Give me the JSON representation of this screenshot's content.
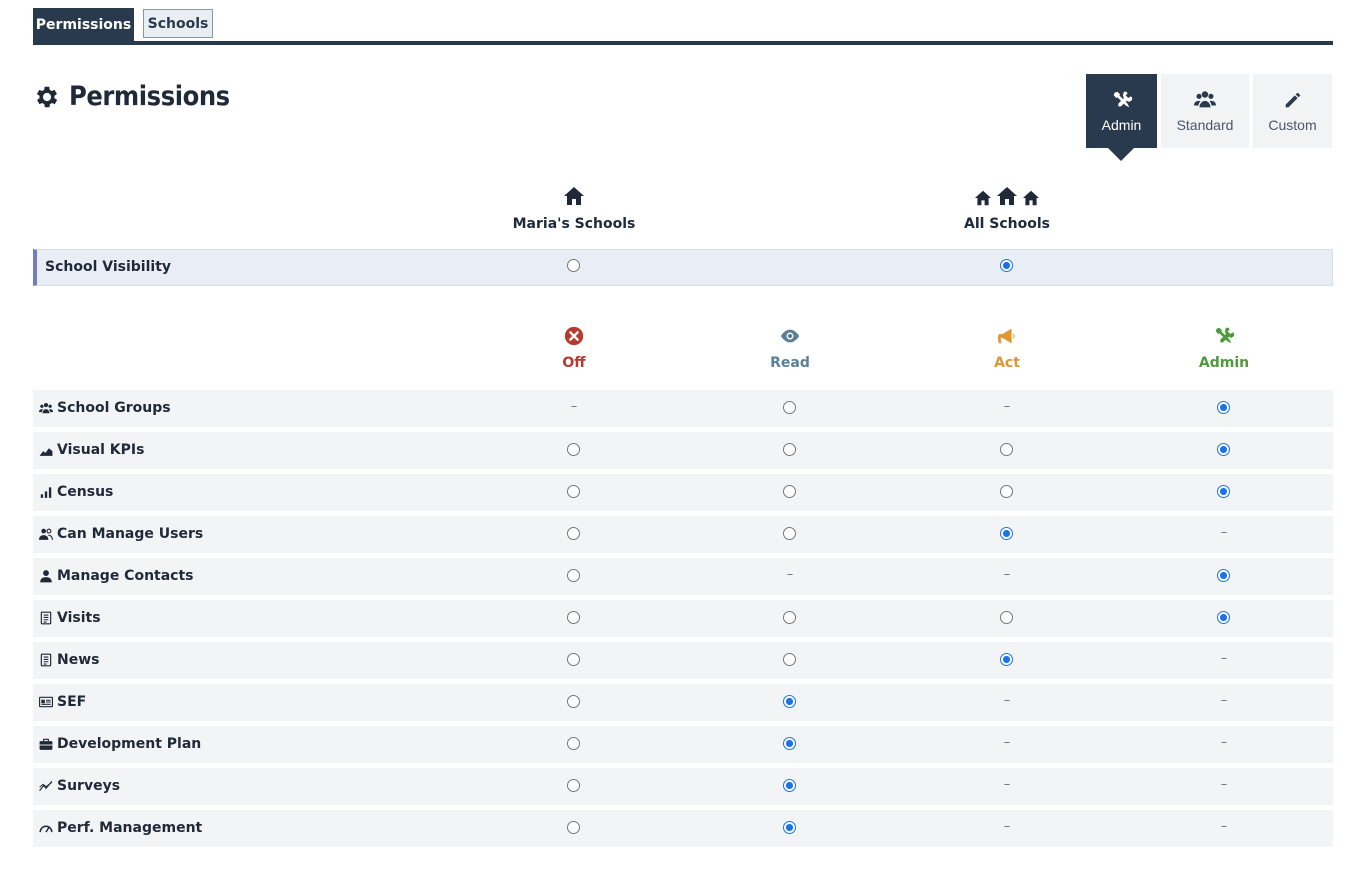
{
  "tabs": [
    {
      "label": "Permissions",
      "active": true
    },
    {
      "label": "Schools",
      "active": false
    }
  ],
  "page_title": "Permissions",
  "presets": [
    {
      "label": "Admin",
      "icon": "tools-icon",
      "selected": true
    },
    {
      "label": "Standard",
      "icon": "users-icon",
      "selected": false
    },
    {
      "label": "Custom",
      "icon": "pencil-icon",
      "selected": false
    }
  ],
  "visibility": {
    "columns": [
      {
        "label": "Maria's Schools",
        "icon": "home-icon"
      },
      {
        "label": "All Schools",
        "icon": "homes-icon"
      }
    ],
    "row_label": "School Visibility",
    "selected": "All Schools"
  },
  "levels": [
    {
      "label": "Off",
      "icon": "x-circle-icon",
      "color": "#b83a2e"
    },
    {
      "label": "Read",
      "icon": "eye-icon",
      "color": "#5b7f99"
    },
    {
      "label": "Act",
      "icon": "megaphone-icon",
      "color": "#e0962e"
    },
    {
      "label": "Admin",
      "icon": "tools-icon",
      "color": "#4f9a3c"
    }
  ],
  "permissions": [
    {
      "label": "School Groups",
      "icon": "group-icon",
      "cells": [
        "-",
        "o",
        "-",
        "x"
      ]
    },
    {
      "label": "Visual KPIs",
      "icon": "area-chart-icon",
      "cells": [
        "o",
        "o",
        "o",
        "x"
      ]
    },
    {
      "label": "Census",
      "icon": "bar-chart-icon",
      "cells": [
        "o",
        "o",
        "o",
        "x"
      ]
    },
    {
      "label": "Can Manage Users",
      "icon": "users-manage-icon",
      "cells": [
        "o",
        "o",
        "x",
        "-"
      ]
    },
    {
      "label": "Manage Contacts",
      "icon": "user-icon",
      "cells": [
        "o",
        "-",
        "-",
        "x"
      ]
    },
    {
      "label": "Visits",
      "icon": "document-icon",
      "cells": [
        "o",
        "o",
        "o",
        "x"
      ]
    },
    {
      "label": "News",
      "icon": "document-icon",
      "cells": [
        "o",
        "o",
        "x",
        "-"
      ]
    },
    {
      "label": "SEF",
      "icon": "id-card-icon",
      "cells": [
        "o",
        "x",
        "-",
        "-"
      ]
    },
    {
      "label": "Development Plan",
      "icon": "briefcase-icon",
      "cells": [
        "o",
        "x",
        "-",
        "-"
      ]
    },
    {
      "label": "Surveys",
      "icon": "trend-icon",
      "cells": [
        "o",
        "x",
        "-",
        "-"
      ]
    },
    {
      "label": "Perf. Management",
      "icon": "gauge-icon",
      "cells": [
        "o",
        "x",
        "-",
        "-"
      ]
    }
  ]
}
